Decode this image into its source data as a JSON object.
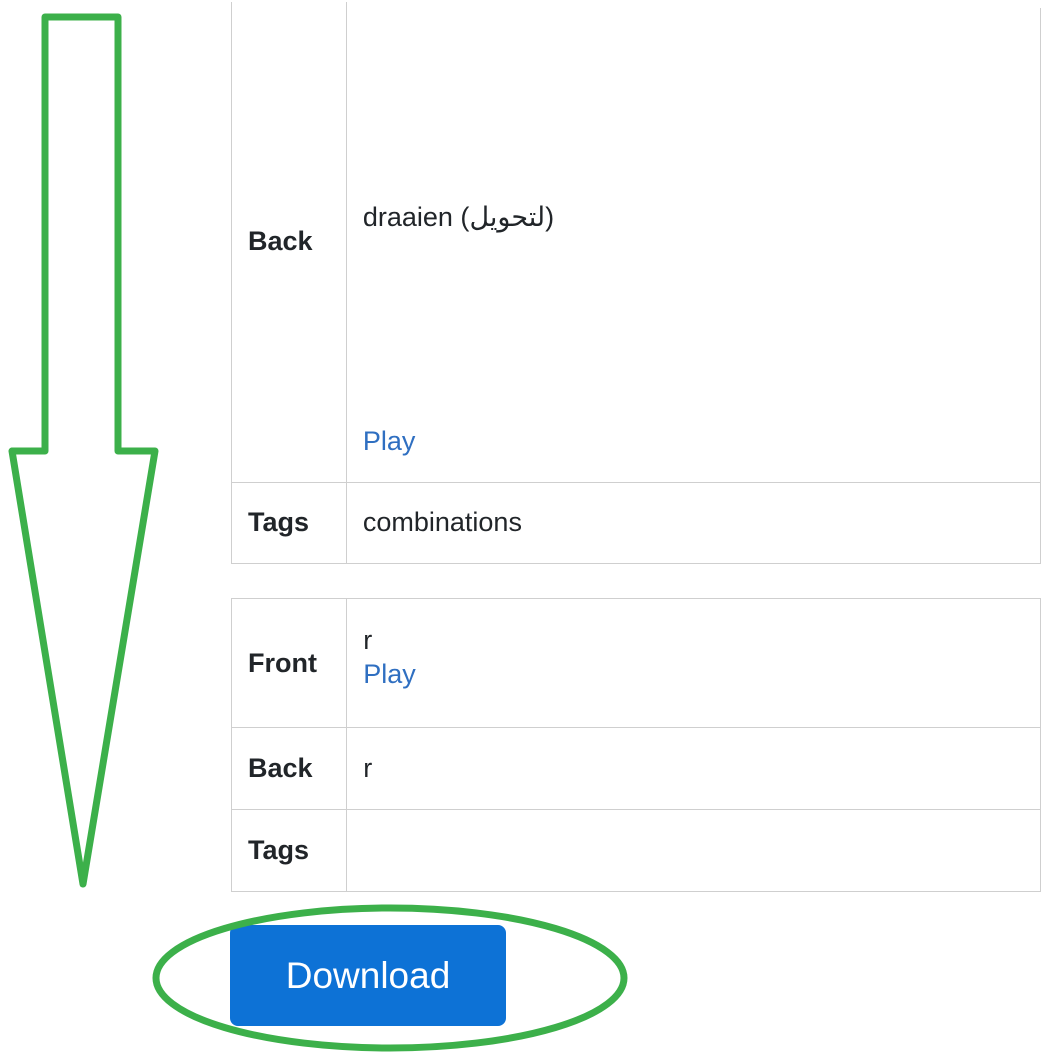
{
  "cards": [
    {
      "back_label": "Back",
      "back_text": "draaien (لتحويل)",
      "back_play": "Play",
      "tags_label": "Tags",
      "tags_value": "combinations"
    },
    {
      "front_label": "Front",
      "front_text": "r",
      "front_play": "Play",
      "back_label": "Back",
      "back_text": "r",
      "tags_label": "Tags",
      "tags_value": ""
    }
  ],
  "download_label": "Download",
  "annotation": {
    "color": "#3cb04a",
    "arrow": "down-arrow-annotation",
    "highlight": "ellipse-highlight-annotation"
  }
}
